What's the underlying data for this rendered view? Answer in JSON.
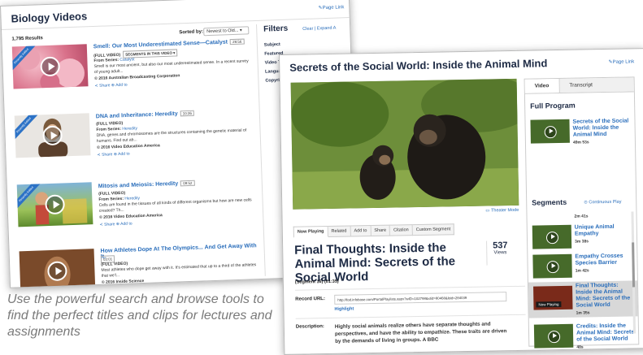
{
  "back_window": {
    "title": "Biology Videos",
    "page_link": "Page Link",
    "results": "1,795 Results",
    "sorted_label": "Sorted by:",
    "sort_value": "Newest to Old... ▾",
    "filters_title": "Filters",
    "clear_expand": "Clear | Expand A",
    "filter_items": [
      "Subject",
      "Featured",
      "Video Typ",
      "Language",
      "Copyrigh"
    ],
    "ribbon_text": "Recently Added",
    "videos": [
      {
        "title": "Smell: Our Most Underestimated Sense—Catalyst",
        "duration": "28:56",
        "type": "(FULL VIDEO)",
        "segments": "SEGMENTS IN THIS VIDEO ▾",
        "series_label": "From Series:",
        "series": "Catalyst",
        "desc": "Smell is our most ancient, but also our most underestimated sense. In a recent survey of young adult...",
        "copyright": "© 2016 Australian Broadcasting Corporation",
        "share": "Share",
        "add": "Add to"
      },
      {
        "title": "DNA and Inheritance: Heredity",
        "duration": "10:36",
        "type": "(FULL VIDEO)",
        "series_label": "From Series:",
        "series": "Heredity",
        "desc": "DNA, genes and chromosomes are the structures containing the genetic material of humans. Find out ab...",
        "copyright": "© 2016 Video Education America",
        "share": "Share",
        "add": "Add to"
      },
      {
        "title": "Mitosis and Meiosis: Heredity",
        "duration": "09:52",
        "type": "(FULL VIDEO)",
        "series_label": "From Series:",
        "series": "Heredity",
        "desc": "Cells are found in the tissues of all kinds of different organisms but how are new cells created? Th...",
        "copyright": "© 2016 Video Education America",
        "share": "Share",
        "add": "Add to"
      },
      {
        "title": "How Athletes Dope At The Olympics... And Get Away With It.",
        "duration": "03:01",
        "type": "(FULL VIDEO)",
        "desc": "Most athletes who dope get away with it. It's estimated that up to a third of the athletes that we'l...",
        "copyright": "© 2016 Inside Science"
      }
    ]
  },
  "front_window": {
    "title": "Secrets of the Social World: Inside the Animal Mind",
    "page_link": "Page Link",
    "theater_mode": "Theater Mode",
    "tabs": [
      "Now Playing",
      "Related",
      "Add to",
      "Share",
      "Citation",
      "Custom Segment"
    ],
    "segment_title": "Final Thoughts: Inside the Animal Mind: Secrets of the Social World",
    "views_count": "537",
    "views_label": "Views",
    "segment_num": "(Segment 16) (01:35)",
    "record_url_label": "Record URL:",
    "record_url": "http://fod.infobase.com/PortalPlaylists.aspx?wID=102798&xtid=80468&loid=284039",
    "highlight": "Highlight",
    "description_label": "Description:",
    "description": "Highly social animals realize others have separate thoughts and perspectives, and have the ability to empathize. These traits are driven by the demands of living in groups. A BBC",
    "sidebar": {
      "tab_video": "Video",
      "tab_transcript": "Transcript",
      "full_program": "Full Program",
      "program_title": "Secrets of the Social World: Inside the Animal Mind",
      "program_dur": "49m 53s",
      "segments_title": "Segments",
      "continuous_play": "Continuous Play",
      "now_playing_label": "Now Playing",
      "segments": [
        {
          "title": "",
          "dur": "2m 41s"
        },
        {
          "title": "Unique Animal Empathy",
          "dur": "3m 38s"
        },
        {
          "title": "Empathy Crosses Species Barrier",
          "dur": "1m 42s"
        },
        {
          "title": "Final Thoughts: Inside the Animal Mind: Secrets of the Social World",
          "dur": "1m 35s"
        },
        {
          "title": "Credits: Inside the Animal Mind: Secrets of the Social World",
          "dur": "48s"
        }
      ]
    }
  },
  "caption": "Use the powerful search and browse tools to find the perfect titles and clips for lectures and assignments",
  "colors": {
    "link": "#2a6ebb",
    "heading": "#1d2a44",
    "ribbon": "#2c72c6"
  }
}
